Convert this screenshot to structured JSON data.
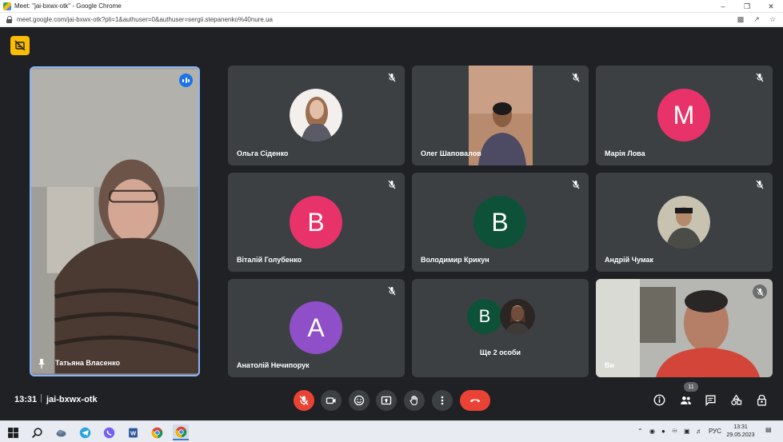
{
  "browser": {
    "title": "Meet: \"jai-bxwx-otk\" - Google Chrome",
    "url": "meet.google.com/jai-bxwx-otk?pli=1&authuser=0&authuser=sergii.stepanenko%40nure.ua"
  },
  "tiles": {
    "main": {
      "name": "Татьяна Власенко"
    },
    "t1": {
      "name": "Ольга Сіденко"
    },
    "t2": {
      "name": "Олег Шаповалов"
    },
    "t3": {
      "name": "Марія Лова",
      "initial": "M"
    },
    "t4": {
      "name": "Віталій Голубенко",
      "initial": "В"
    },
    "t5": {
      "name": "Володимир Крикун",
      "initial": "В"
    },
    "t6": {
      "name": "Андрій Чумак"
    },
    "t7": {
      "name": "Анатолій Нечипорук",
      "initial": "A"
    },
    "t8": {
      "label": "Ще 2 особи",
      "initial": "В"
    },
    "t9": {
      "name": "Ви"
    }
  },
  "bottombar": {
    "time": "13:31",
    "separator": "|",
    "meeting_code": "jai-bxwx-otk",
    "participants_count": "11"
  },
  "taskbar": {
    "lang": "РУС",
    "time": "13:31",
    "date": "29.05.2023"
  },
  "colors": {
    "accent_red": "#ea4335",
    "speaking_blue": "#1a73e8",
    "tile_bg": "#3c4043",
    "avatar_pink": "#e8336a",
    "avatar_green": "#0d5138",
    "avatar_purple": "#8e4fc8"
  }
}
